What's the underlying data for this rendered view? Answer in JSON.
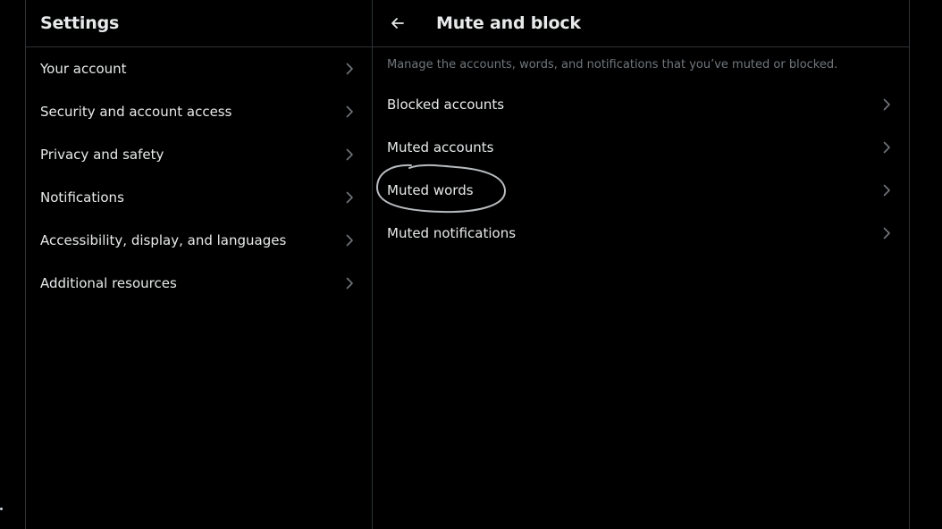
{
  "settings": {
    "title": "Settings",
    "items": [
      {
        "label": "Your account"
      },
      {
        "label": "Security and account access"
      },
      {
        "label": "Privacy and safety"
      },
      {
        "label": "Notifications"
      },
      {
        "label": "Accessibility, display, and languages"
      },
      {
        "label": "Additional resources"
      }
    ]
  },
  "mute_block": {
    "back_icon": "arrow-left-icon",
    "title": "Mute and block",
    "description": "Manage the accounts, words, and notifications that you’ve muted or blocked.",
    "items": [
      {
        "label": "Blocked accounts"
      },
      {
        "label": "Muted accounts"
      },
      {
        "label": "Muted words"
      },
      {
        "label": "Muted notifications"
      }
    ]
  },
  "colors": {
    "background": "#000000",
    "text_primary": "#e7e9ea",
    "text_secondary": "#71767b",
    "border": "#2f3336",
    "annotation": "#b9bcbf"
  },
  "icons": {
    "chevron": "chevron-right-icon"
  }
}
